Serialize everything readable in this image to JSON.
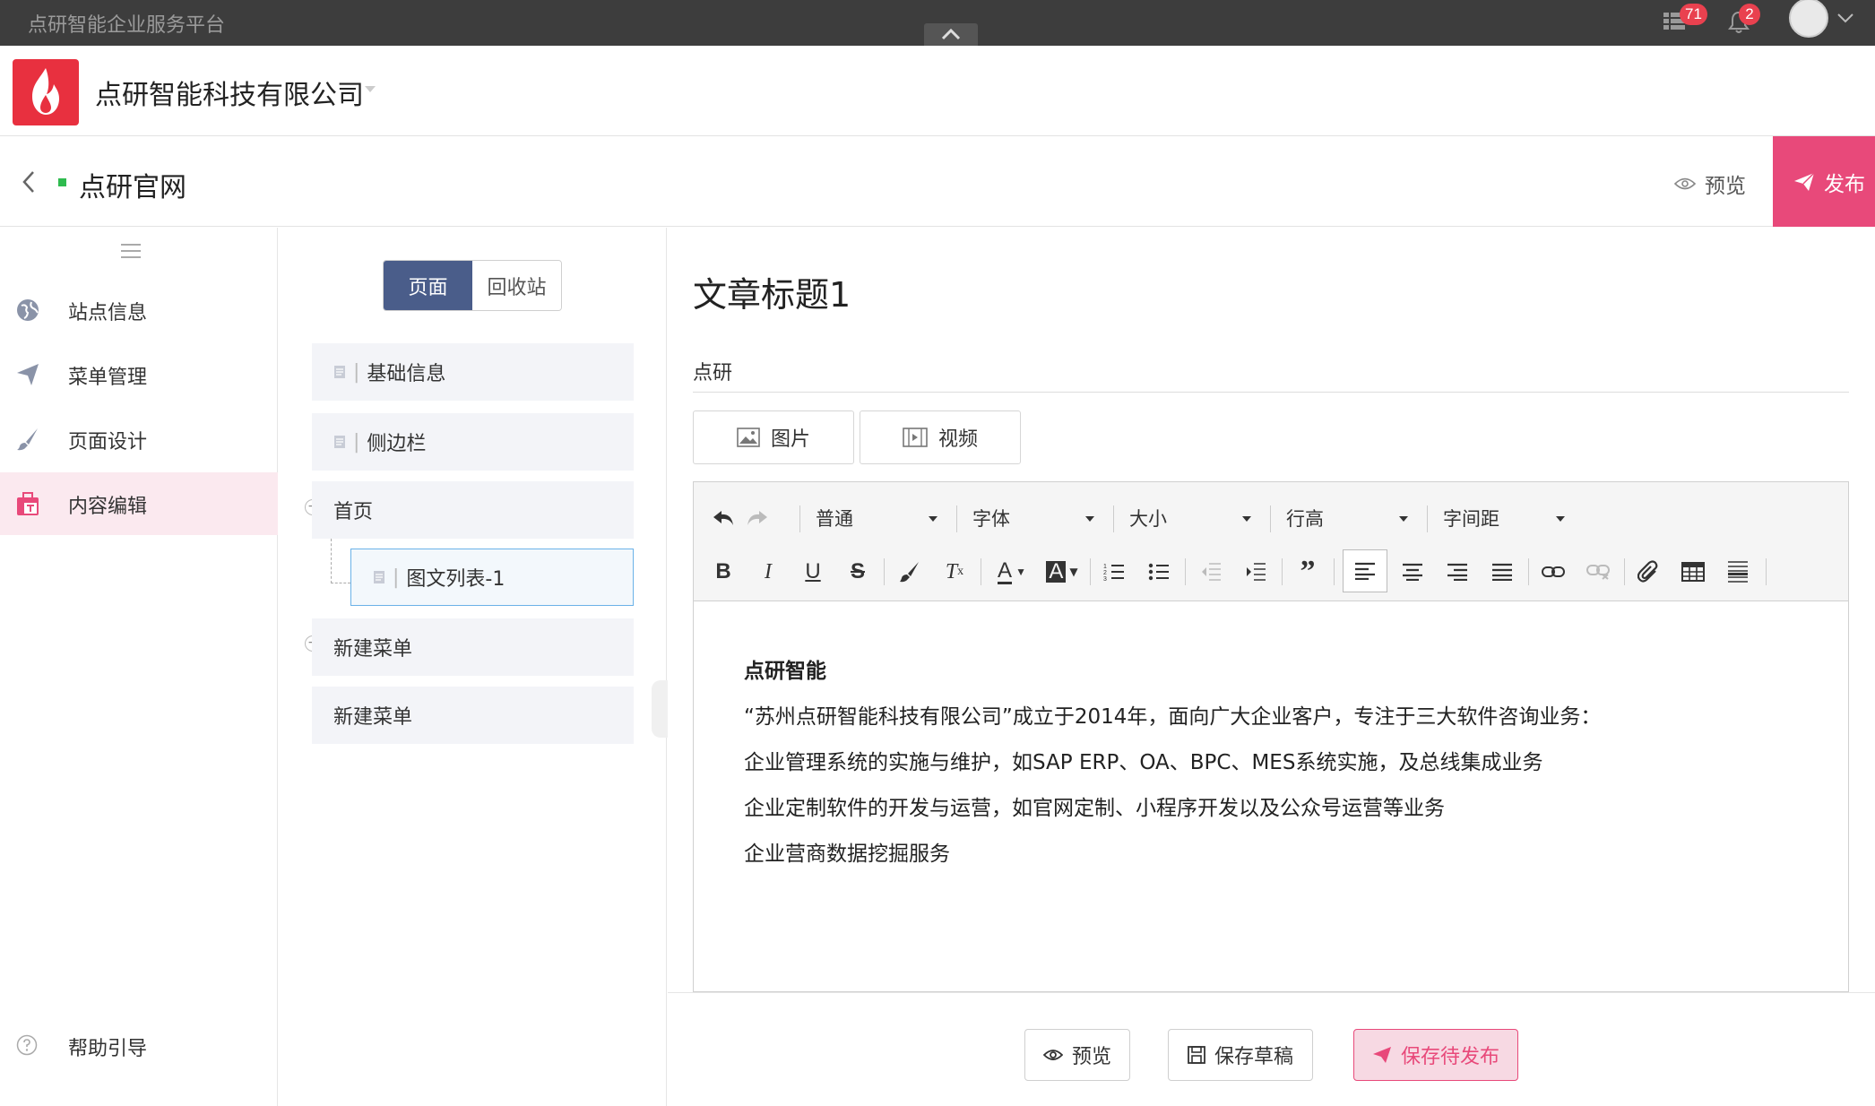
{
  "topbar": {
    "app_title": "点研智能企业服务平台",
    "apps_badge": "71",
    "notify_badge": "2"
  },
  "company": {
    "name": "点研智能科技有限公司"
  },
  "site": {
    "name": "点研官网",
    "preview_label": "预览",
    "publish_label": "发布"
  },
  "sidebar": {
    "items": [
      {
        "label": "站点信息",
        "icon": "globe-icon"
      },
      {
        "label": "菜单管理",
        "icon": "send-icon"
      },
      {
        "label": "页面设计",
        "icon": "brush-icon"
      },
      {
        "label": "内容编辑",
        "icon": "content-edit-icon"
      }
    ],
    "help_label": "帮助引导"
  },
  "tree": {
    "tabs": [
      "页面",
      "回收站"
    ],
    "nodes": [
      "基础信息",
      "侧边栏",
      "首页",
      "图文列表-1",
      "新建菜单",
      "新建菜单"
    ]
  },
  "article": {
    "title": "文章标题1",
    "author": "点研",
    "image_btn": "图片",
    "video_btn": "视频"
  },
  "toolbar": {
    "format": "普通",
    "font": "字体",
    "size": "大小",
    "line_height": "行高",
    "letter_spacing": "字间距"
  },
  "content": {
    "heading": "点研智能",
    "lines": [
      "“苏州点研智能科技有限公司”成立于2014年，面向广大企业客户，专注于三大软件咨询业务：",
      "企业管理系统的实施与维护，如SAP ERP、OA、BPC、MES系统实施，及总线集成业务",
      "企业定制软件的开发与运营，如官网定制、小程序开发以及公众号运营等业务",
      "企业营商数据挖掘服务"
    ]
  },
  "actions": {
    "preview": "预览",
    "save_draft": "保存草稿",
    "save_publish": "保存待发布"
  },
  "colors": {
    "accent": "#e8497a",
    "primary": "#4a5d8a",
    "status": "#2fbb4f"
  }
}
